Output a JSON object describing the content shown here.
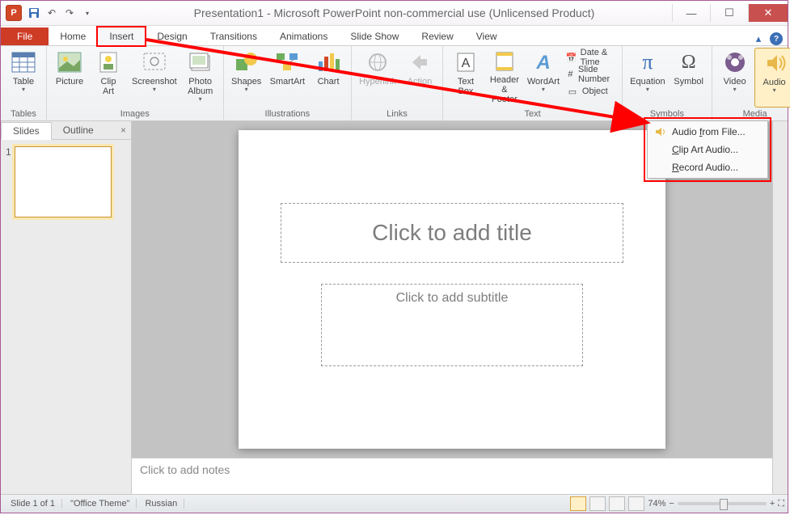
{
  "title": "Presentation1 - Microsoft PowerPoint non-commercial use (Unlicensed Product)",
  "tabs": {
    "file": "File",
    "home": "Home",
    "insert": "Insert",
    "design": "Design",
    "transitions": "Transitions",
    "animations": "Animations",
    "slideshow": "Slide Show",
    "review": "Review",
    "view": "View"
  },
  "ribbon": {
    "tables": {
      "label": "Tables",
      "table": "Table"
    },
    "images": {
      "label": "Images",
      "picture": "Picture",
      "clipart": "Clip\nArt",
      "screenshot": "Screenshot",
      "photoalbum": "Photo\nAlbum"
    },
    "illus": {
      "label": "Illustrations",
      "shapes": "Shapes",
      "smartart": "SmartArt",
      "chart": "Chart"
    },
    "links": {
      "label": "Links",
      "hyperlink": "Hyperlink",
      "action": "Action"
    },
    "text": {
      "label": "Text",
      "textbox": "Text\nBox",
      "headerfooter": "Header\n& Footer",
      "wordart": "WordArt",
      "datetime": "Date & Time",
      "slidenumber": "Slide Number",
      "object": "Object"
    },
    "symbols": {
      "label": "Symbols",
      "equation": "Equation",
      "symbol": "Symbol"
    },
    "media": {
      "label": "Media",
      "video": "Video",
      "audio": "Audio"
    }
  },
  "dropdown": {
    "item1": "Audio from File...",
    "item2": "Clip Art Audio...",
    "item3": "Record Audio...",
    "u1": "f",
    "u2": "C",
    "u3": "R"
  },
  "side": {
    "slides": "Slides",
    "outline": "Outline",
    "num": "1"
  },
  "slide": {
    "title": "Click to add title",
    "subtitle": "Click to add subtitle"
  },
  "notes": "Click to add notes",
  "status": {
    "slide": "Slide 1 of 1",
    "theme": "\"Office Theme\"",
    "lang": "Russian",
    "zoom": "74%"
  }
}
